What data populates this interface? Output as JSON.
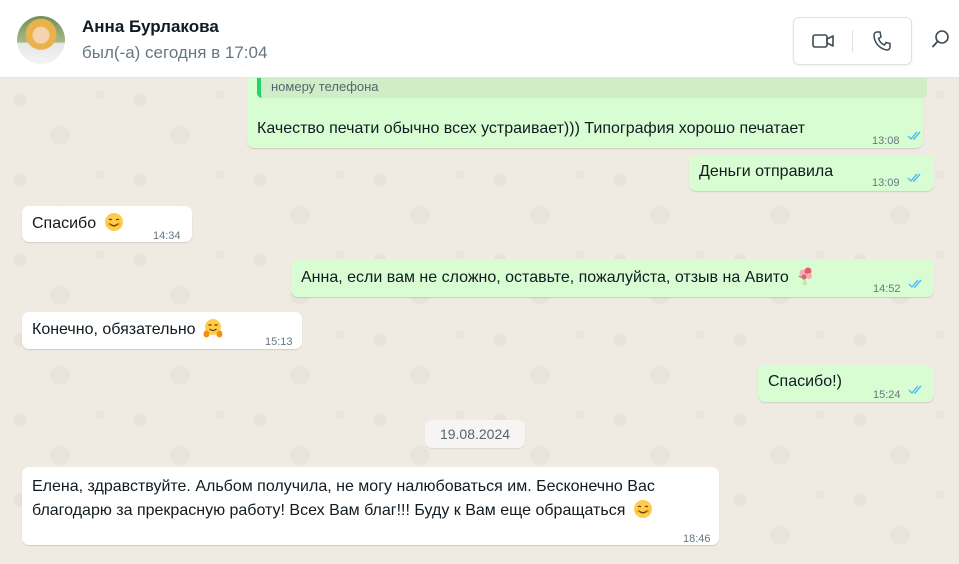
{
  "header": {
    "contact_name": "Анна Бурлакова",
    "last_seen": "был(-а) сегодня в 17:04",
    "video_call_icon": "video-camera-icon",
    "voice_call_icon": "phone-icon",
    "search_icon": "search-icon"
  },
  "colors": {
    "outgoing_bubble": "#d9fdd3",
    "incoming_bubble": "#ffffff",
    "read_ticks": "#53bdeb",
    "chat_background": "#efeae2"
  },
  "messages": [
    {
      "direction": "out",
      "quoted_text": "номеру телефона",
      "text": "Качество печати обычно всех устраивает))) Типография хорошо печатает",
      "time": "13:08",
      "status": "read"
    },
    {
      "direction": "out",
      "text": "Деньги отправила",
      "time": "13:09",
      "status": "read"
    },
    {
      "direction": "in",
      "text": "Спасибо",
      "emoji": "smiling-face-icon",
      "time": "14:34"
    },
    {
      "direction": "out",
      "text": "Анна, если вам не сложно, оставьте, пожалуйста, отзыв на Авито",
      "emoji": "flower-bouquet-icon",
      "time": "14:52",
      "status": "read"
    },
    {
      "direction": "in",
      "text": "Конечно, обязательно",
      "emoji": "hugging-face-icon",
      "time": "15:13"
    },
    {
      "direction": "out",
      "text": "Спасибо!)",
      "time": "15:24",
      "status": "read"
    },
    {
      "direction": "in",
      "text_line1": "Елена, здравствуйте. Альбом получила, не могу налюбоваться им. Бесконечно Вас",
      "text_line2": "благодарю за прекрасную работу! Всех Вам благ!!! Буду к Вам еще обращаться",
      "emoji": "smiling-face-icon",
      "time": "18:46"
    }
  ],
  "date_separator": "19.08.2024"
}
